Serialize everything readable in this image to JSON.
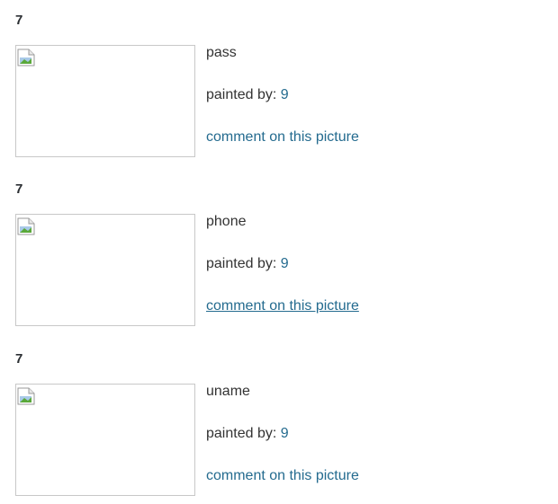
{
  "entries": [
    {
      "heading": "7",
      "title": "pass",
      "painted_by_label": "painted by: ",
      "painter": "9",
      "comment_link": "comment on this picture",
      "comment_link_hovered": false
    },
    {
      "heading": "7",
      "title": "phone",
      "painted_by_label": "painted by: ",
      "painter": "9",
      "comment_link": "comment on this picture",
      "comment_link_hovered": true
    },
    {
      "heading": "7",
      "title": "uname",
      "painted_by_label": "painted by: ",
      "painter": "9",
      "comment_link": "comment on this picture",
      "comment_link_hovered": false
    }
  ],
  "colors": {
    "link": "#246b8f",
    "text": "#333333",
    "thumb_border": "#c8c8c8"
  },
  "icons": {
    "thumbnail": "broken-image-icon"
  }
}
